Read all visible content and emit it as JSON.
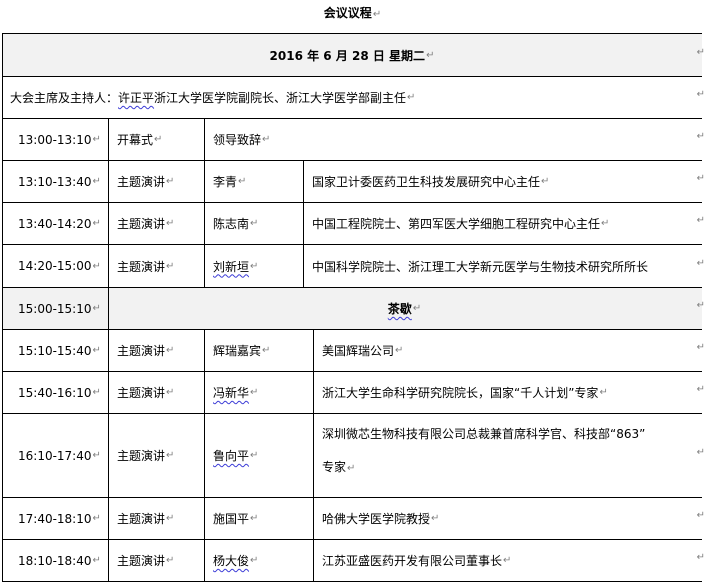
{
  "title": "会议议程",
  "para_mark": "↵",
  "date_header": "2016 年  6 月 28 日  星期二",
  "chair": {
    "label": "大会主席及主持人：",
    "name": "许正平",
    "desc": " 浙江大学医学院副院长、浙江大学医学部副主任"
  },
  "rows": [
    {
      "time": "13:00-13:10",
      "type": "开幕式",
      "name": "领导致辞",
      "org": ""
    },
    {
      "time": "13:10-13:40",
      "type": "主题演讲",
      "name": "李青",
      "org": "国家卫计委医药卫生科技发展研究中心主任"
    },
    {
      "time": "13:40-14:20",
      "type": "主题演讲",
      "name": "陈志南",
      "org": "中国工程院院士、第四军医大学细胞工程研究中心主任"
    },
    {
      "time": "14:20-15:00",
      "type": "主题演讲",
      "name": "刘新垣",
      "org": "中国科学院院士、浙江理工大学新元医学与生物技术研究所所长"
    },
    {
      "time": "15:00-15:10",
      "type": "",
      "name": "茶歇",
      "org": ""
    },
    {
      "time": "15:10-15:40",
      "type": "主题演讲",
      "name": "辉瑞嘉宾",
      "org": "美国辉瑞公司"
    },
    {
      "time": "15:40-16:10",
      "type": "主题演讲",
      "name": "冯新华",
      "org": "浙江大学生命科学研究院院长，国家“千人计划”专家"
    },
    {
      "time": "16:10-17:40",
      "type": "主题演讲",
      "name": "鲁向平",
      "org_line1": "深圳微芯生物科技有限公司总裁兼首席科学官、科技部“863”",
      "org_line2": "专家"
    },
    {
      "time": "17:40-18:10",
      "type": "主题演讲",
      "name": "施国平",
      "org": "哈佛大学医学院教授"
    },
    {
      "time": "18:10-18:40",
      "type": "主题演讲",
      "name": "杨大俊",
      "org": "江苏亚盛医药开发有限公司董事长"
    }
  ]
}
